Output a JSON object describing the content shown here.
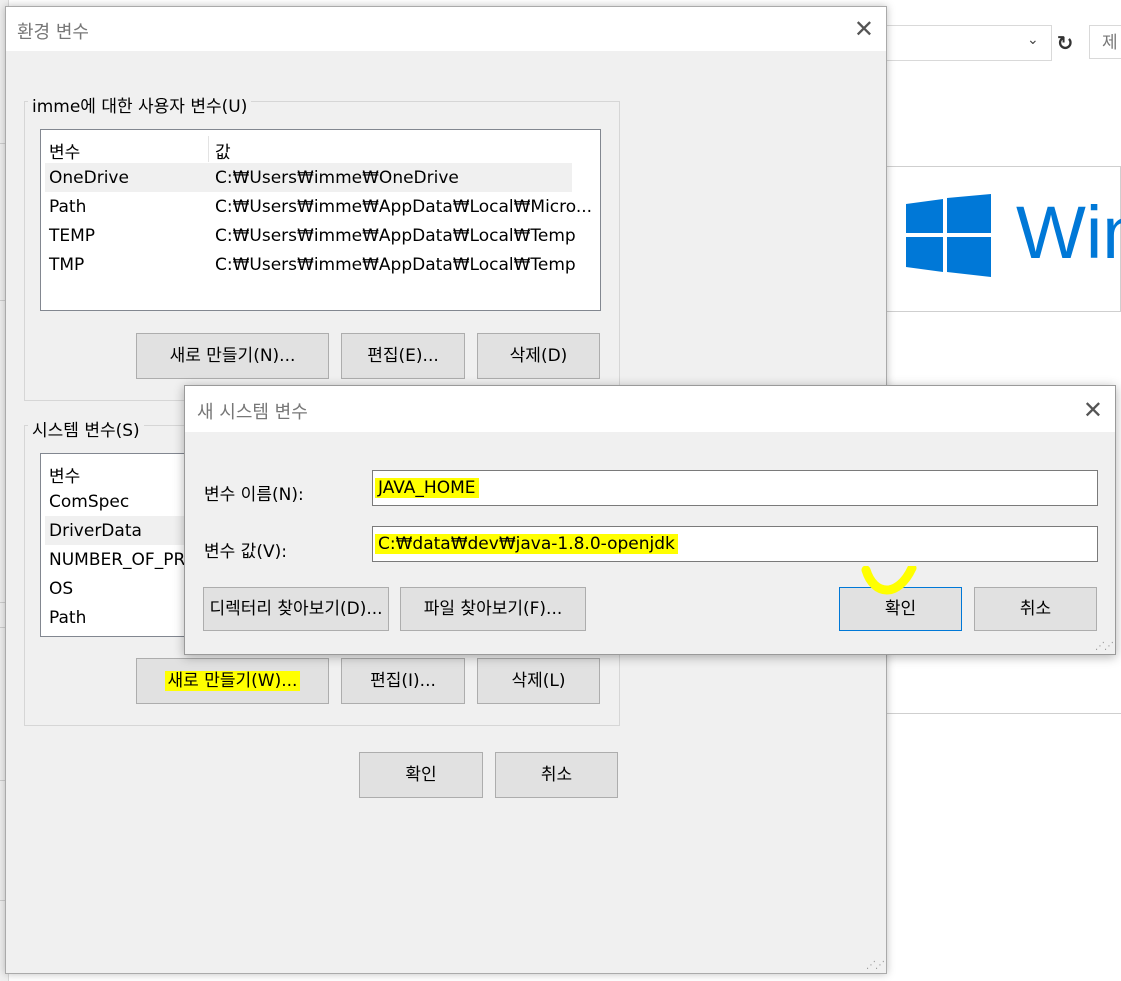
{
  "background": {
    "search_placeholder": "제",
    "brand_text": "Win",
    "brand_color": "#0078d7"
  },
  "env_dialog": {
    "title": "환경 변수",
    "user_group_label": "imme에 대한 사용자 변수(U)",
    "user_columns": [
      "변수",
      "값"
    ],
    "user_rows": [
      {
        "name": "OneDrive",
        "value": "C:₩Users₩imme₩OneDrive"
      },
      {
        "name": "Path",
        "value": "C:₩Users₩imme₩AppData₩Local₩Micro..."
      },
      {
        "name": "TEMP",
        "value": "C:₩Users₩imme₩AppData₩Local₩Temp"
      },
      {
        "name": "TMP",
        "value": "C:₩Users₩imme₩AppData₩Local₩Temp"
      }
    ],
    "user_buttons": {
      "new": "새로 만들기(N)...",
      "edit": "편집(E)...",
      "delete": "삭제(D)"
    },
    "system_group_label": "시스템 변수(S)",
    "system_columns": [
      "변수"
    ],
    "system_rows": [
      "ComSpec",
      "DriverData",
      "NUMBER_OF_PR",
      "OS",
      "Path"
    ],
    "system_buttons": {
      "new": "새로 만들기(W)...",
      "edit": "편집(I)...",
      "delete": "삭제(L)"
    },
    "ok": "확인",
    "cancel": "취소"
  },
  "new_var_dialog": {
    "title": "새 시스템 변수",
    "name_label": "변수 이름(N):",
    "name_value": "JAVA_HOME",
    "value_label": "변수 값(V):",
    "value_value": "C:₩data₩dev₩java-1.8.0-openjdk",
    "browse_dir": "디렉터리 찾아보기(D)...",
    "browse_file": "파일 찾아보기(F)...",
    "ok": "확인",
    "cancel": "취소"
  },
  "highlight_color": "#ffff00"
}
